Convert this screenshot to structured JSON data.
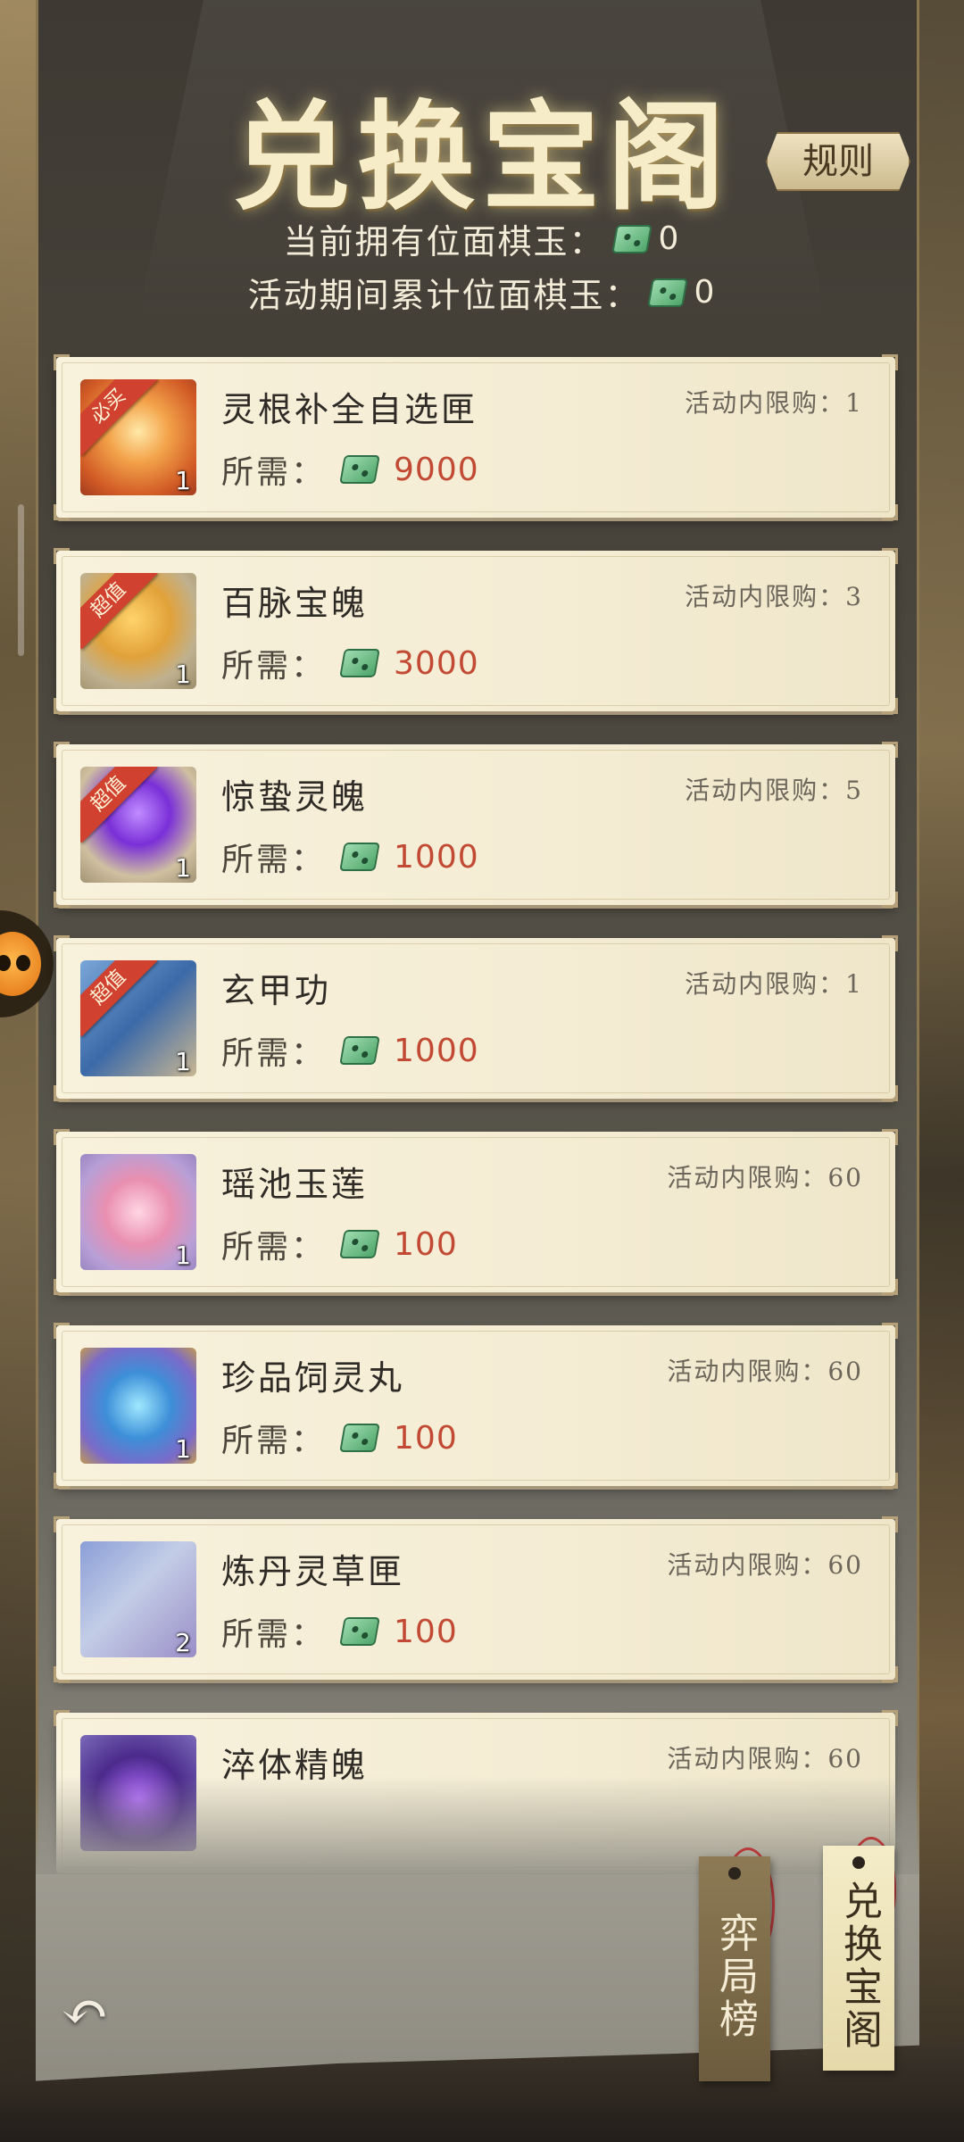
{
  "header": {
    "title": "兑换宝阁",
    "rules_label": "规则",
    "stats": [
      {
        "label": "当前拥有位面棋玉：",
        "value": "0"
      },
      {
        "label": "活动期间累计位面棋玉：",
        "value": "0"
      }
    ]
  },
  "items": [
    {
      "name": "灵根补全自选匣",
      "badge": "必买",
      "qty": "1",
      "limit": "活动内限购：1",
      "cost_label": "所需：",
      "price": "9000"
    },
    {
      "name": "百脉宝魄",
      "badge": "超值",
      "qty": "1",
      "limit": "活动内限购：3",
      "cost_label": "所需：",
      "price": "3000"
    },
    {
      "name": "惊蛰灵魄",
      "badge": "超值",
      "qty": "1",
      "limit": "活动内限购：5",
      "cost_label": "所需：",
      "price": "1000"
    },
    {
      "name": "玄甲功",
      "badge": "超值",
      "qty": "1",
      "limit": "活动内限购：1",
      "cost_label": "所需：",
      "price": "1000"
    },
    {
      "name": "瑶池玉莲",
      "badge": "",
      "qty": "1",
      "limit": "活动内限购：60",
      "cost_label": "所需：",
      "price": "100"
    },
    {
      "name": "珍品饲灵丸",
      "badge": "",
      "qty": "1",
      "limit": "活动内限购：60",
      "cost_label": "所需：",
      "price": "100"
    },
    {
      "name": "炼丹灵草匣",
      "badge": "",
      "qty": "2",
      "limit": "活动内限购：60",
      "cost_label": "所需：",
      "price": "100"
    },
    {
      "name": "淬体精魄",
      "badge": "",
      "qty": "",
      "limit": "活动内限购：60",
      "cost_label": "",
      "price": ""
    }
  ],
  "tabs": {
    "rank_label": "弈局榜",
    "exchange_label": "兑换宝阁"
  },
  "icons": {
    "currency": "jade-chess-icon",
    "back": "back-arrow-icon"
  },
  "colors": {
    "price": "#c24a34",
    "badge": "#d0412f",
    "card": "#f4ecd3"
  }
}
